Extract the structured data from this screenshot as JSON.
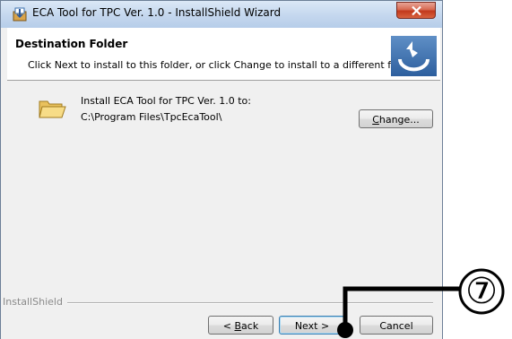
{
  "window": {
    "title": "ECA Tool for TPC Ver. 1.0 - InstallShield Wizard",
    "icon": "installer-icon",
    "close_icon": "close-icon"
  },
  "header": {
    "title": "Destination Folder",
    "subtitle": "Click Next to install to this folder, or click Change to install to a different folder.",
    "logo_icon": "installshield-logo-icon"
  },
  "body": {
    "folder_icon": "folder-icon",
    "install_line": "Install ECA Tool for TPC Ver. 1.0 to:",
    "install_path": "C:\\Program Files\\TpcEcaTool\\",
    "change_button": {
      "prefix": "",
      "accel": "C",
      "suffix": "hange..."
    }
  },
  "footer": {
    "brand": "InstallShield",
    "back_button": {
      "prefix": "< ",
      "accel": "B",
      "suffix": "ack"
    },
    "next_button": "Next >",
    "cancel_button": "Cancel"
  },
  "annotation": {
    "callout_number": "⑦"
  },
  "colors": {
    "dialog_bg": "#f0f0f0",
    "title_bar": "#c4d7ee",
    "close_button": "#c2391c",
    "logo_blue": "#3a6fae"
  }
}
